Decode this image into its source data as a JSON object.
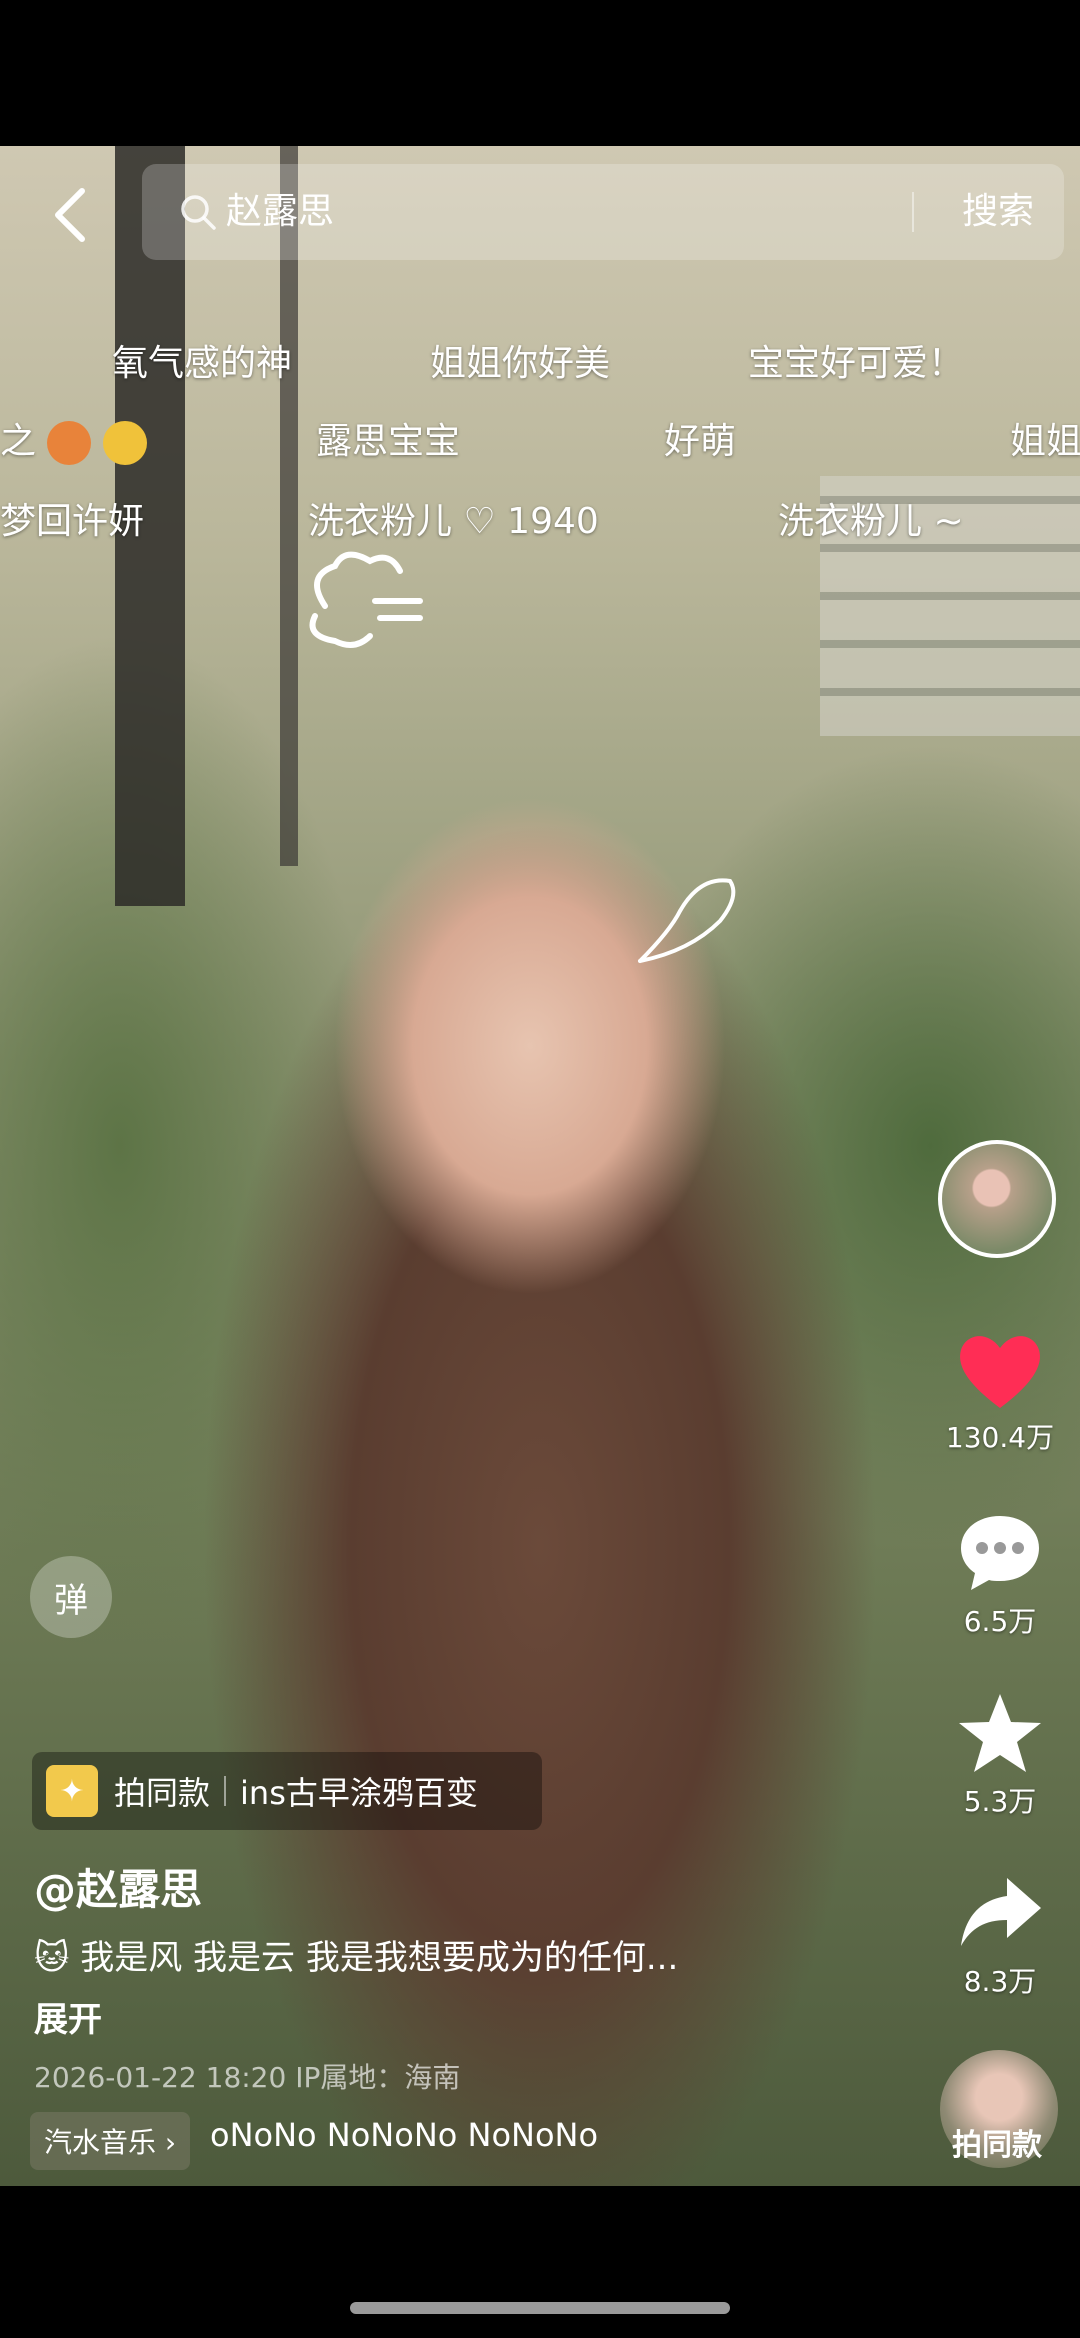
{
  "search": {
    "query": "赵露思",
    "button": "搜索"
  },
  "danmaku": [
    {
      "text": "氧气感的神"
    },
    {
      "text": "姐姐你好美"
    },
    {
      "text": "宝宝好可爱！"
    },
    {
      "text": "之"
    },
    {
      "text": "露思宝宝"
    },
    {
      "text": "好萌"
    },
    {
      "text": "姐姐"
    },
    {
      "text": "梦回许妍"
    },
    {
      "text": "洗衣粉儿 ♡ 1940"
    },
    {
      "text": "洗衣粉儿 ~"
    }
  ],
  "actions": {
    "likes": "130.4万",
    "comments": "6.5万",
    "favorites": "5.3万",
    "shares": "8.3万"
  },
  "danmu_button": "弹",
  "template": {
    "label": "拍同款",
    "name": "ins古早涂鸦百变"
  },
  "author": "@赵露思",
  "caption": "🐱 我是风 我是云 我是我想要成为的任何...",
  "expand": "展开",
  "meta": "2026-01-22 18:20  IP属地：海南",
  "music": {
    "chip": "汽水音乐 ›",
    "track": "oNoNo    NoNoNo    NoNoNo"
  },
  "same_button": "拍同款",
  "colors": {
    "like": "#ff2d55",
    "background": "#000000"
  }
}
